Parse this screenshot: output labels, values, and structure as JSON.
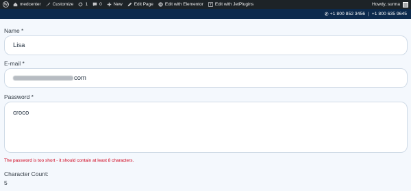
{
  "admin_bar": {
    "site_name": "medcenter",
    "customize": "Customize",
    "updates_count": "1",
    "comments_count": "0",
    "new_label": "New",
    "edit_page": "Edit Page",
    "edit_elementor": "Edit with Elementor",
    "edit_jetplugins": "Edit with JetPlugins",
    "howdy": "Howdy, surma",
    "icons": [
      "wordpress-logo-icon",
      "brush-icon",
      "refresh-icon",
      "comment-icon",
      "plus-icon",
      "pencil-icon",
      "elementor-icon",
      "jet-icon",
      "avatar"
    ]
  },
  "top_strip": {
    "phone_1": "+1 800 852 3456",
    "separator": "|",
    "phone_2": "+1 800 635 9645"
  },
  "form": {
    "name_label": "Name *",
    "name_value": "Lisa",
    "email_label": "E-mail *",
    "email_value_visible": "com",
    "password_label": "Password *",
    "password_value": "croco",
    "error_message": "The password is too short - it should contain at least 8 characters.",
    "char_count_label": "Character Count:",
    "char_count_value": "5"
  },
  "colors": {
    "admin_bar_bg": "#1d2327",
    "strip_bg": "#0c2a4d",
    "page_bg": "#f4f8fd",
    "error": "#d0021b"
  }
}
